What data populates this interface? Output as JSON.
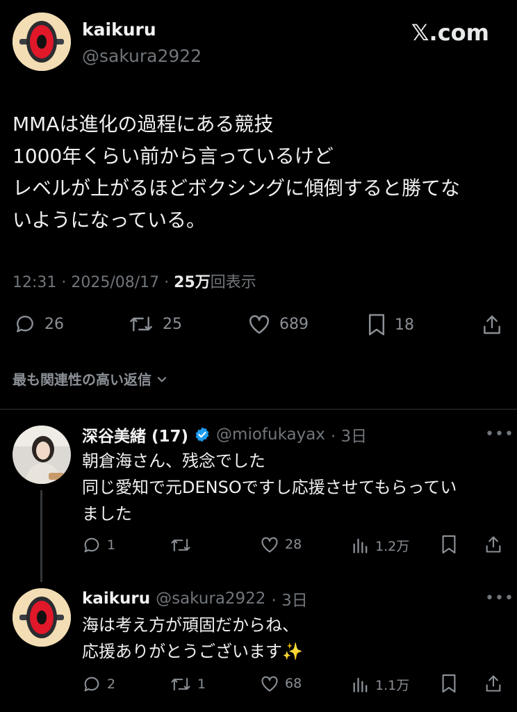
{
  "logo": "𝕏.com",
  "main_post": {
    "author_name": "kaikuru",
    "author_handle": "@sakura2922",
    "lines": [
      "MMAは進化の過程にある競技",
      "1000年くらい前から言っているけど",
      "レベルが上がるほどボクシングに傾倒すると勝てな",
      "いようになっている。"
    ],
    "timestamp": "12:31 · 2025/08/17 · ",
    "views_count": "25万",
    "views_label": "回表示",
    "replies": "26",
    "reposts": "25",
    "likes": "689",
    "bookmarks": "18"
  },
  "sort_label": "最も関連性の高い返信",
  "replies": [
    {
      "author_name": "深谷美緒 (17)",
      "author_handle": "@miofukayax",
      "time": "· 3日",
      "verified": true,
      "lines": [
        "朝倉海さん、残念でした",
        "同じ愛知で元DENSOですし応援させてもらってい",
        "ました"
      ],
      "replies": "1",
      "reposts": "",
      "likes": "28",
      "views": "1.2万"
    },
    {
      "author_name": "kaikuru",
      "author_handle": "@sakura2922",
      "time": "· 3日",
      "lines": [
        "海は考え方が頑固だからね、",
        "応援ありがとうございます✨"
      ],
      "replies": "2",
      "reposts": "1",
      "likes": "68",
      "views": "1.1万"
    }
  ],
  "colors": {
    "background": "#000000",
    "text": "#e7e9ea",
    "muted": "#71767b",
    "verified": "#1d9bf0",
    "wheel_red": "#e0182a"
  }
}
